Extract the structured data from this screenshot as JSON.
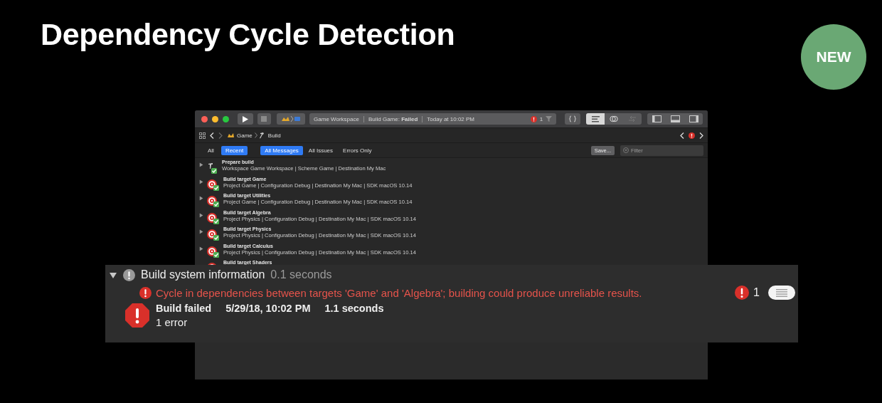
{
  "slide": {
    "title": "Dependency Cycle Detection",
    "badge": "NEW"
  },
  "window": {
    "activity": {
      "workspace": "Game Workspace",
      "status": "Build Game: **Failed**",
      "time": "Today at 10:02 PM",
      "issue_count": "1"
    },
    "path_bar": {
      "items": [
        "Game",
        "Build"
      ]
    },
    "filters": {
      "scope": [
        {
          "label": "All",
          "selected": false
        },
        {
          "label": "Recent",
          "selected": true
        }
      ],
      "messages": [
        {
          "label": "All Messages",
          "selected": true
        },
        {
          "label": "All Issues",
          "selected": false
        },
        {
          "label": "Errors Only",
          "selected": false
        }
      ],
      "save_button": "Save...",
      "filter_field": {
        "placeholder": "Filter"
      }
    },
    "log": [
      {
        "kind": "prepare",
        "title": "Prepare build",
        "detail": "Workspace Game Workspace | Scheme Game | Destination My Mac",
        "expanded": false
      },
      {
        "kind": "target",
        "title": "Build target Game",
        "detail": "Project Game | Configuration Debug | Destination My Mac | SDK macOS 10.14",
        "expanded": false
      },
      {
        "kind": "target",
        "title": "Build target Utilities",
        "detail": "Project Game | Configuration Debug | Destination My Mac | SDK macOS 10.14",
        "expanded": false
      },
      {
        "kind": "target",
        "title": "Build target Algebra",
        "detail": "Project Physics | Configuration Debug | Destination My Mac | SDK macOS 10.14",
        "expanded": false
      },
      {
        "kind": "target",
        "title": "Build target Physics",
        "detail": "Project Physics | Configuration Debug | Destination My Mac | SDK macOS 10.14",
        "expanded": false
      },
      {
        "kind": "target",
        "title": "Build target Calculus",
        "detail": "Project Physics | Configuration Debug | Destination My Mac | SDK macOS 10.14",
        "expanded": false
      },
      {
        "kind": "target",
        "title": "Build target Shaders"
      }
    ]
  },
  "callout": {
    "title": "Build system information",
    "duration": "0.1 seconds",
    "expanded": true,
    "message": "Cycle in dependencies between targets 'Game' and 'Algebra'; building could produce unreliable results.",
    "issue_count": "1",
    "result": {
      "title": "Build failed",
      "date": "5/29/18, 10:02 PM",
      "duration": "1.1 seconds",
      "summary": "1 error"
    }
  }
}
